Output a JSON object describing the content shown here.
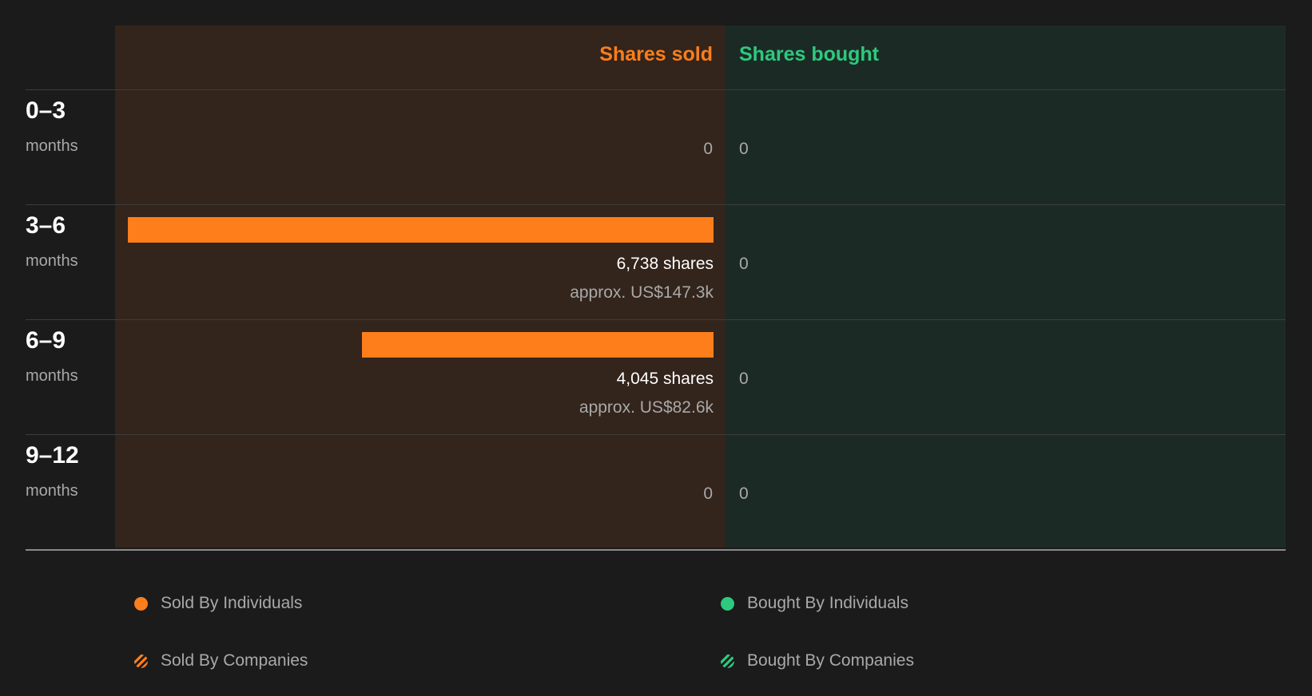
{
  "chart_data": {
    "type": "bar",
    "orientation": "horizontal-diverging",
    "columns": {
      "sold": "Shares sold",
      "bought": "Shares bought"
    },
    "categories": [
      {
        "range": "0–3",
        "unit": "months"
      },
      {
        "range": "3–6",
        "unit": "months"
      },
      {
        "range": "6–9",
        "unit": "months"
      },
      {
        "range": "9–12",
        "unit": "months"
      }
    ],
    "series": [
      {
        "name": "Sold By Individuals",
        "side": "sold",
        "values": [
          0,
          6738,
          4045,
          0
        ],
        "labels": [
          "0",
          "6,738 shares",
          "4,045 shares",
          "0"
        ],
        "approx": [
          "",
          "approx. US$147.3k",
          "approx. US$82.6k",
          ""
        ]
      },
      {
        "name": "Bought By Individuals",
        "side": "bought",
        "values": [
          0,
          0,
          0,
          0
        ],
        "labels": [
          "0",
          "0",
          "0",
          "0"
        ]
      }
    ],
    "max_value": 6738,
    "legend": [
      {
        "label": "Sold By Individuals",
        "style": "solid",
        "color": "#fd7e1b"
      },
      {
        "label": "Bought By Individuals",
        "style": "solid",
        "color": "#2dc97e"
      },
      {
        "label": "Sold By Companies",
        "style": "striped",
        "color": "#fd7e1b"
      },
      {
        "label": "Bought By Companies",
        "style": "striped",
        "color": "#2dc97e"
      }
    ],
    "colors": {
      "sold": "#fd7e1b",
      "bought": "#2dc97e",
      "sold_bg": "#33241c",
      "bought_bg": "#1c2a25"
    }
  }
}
